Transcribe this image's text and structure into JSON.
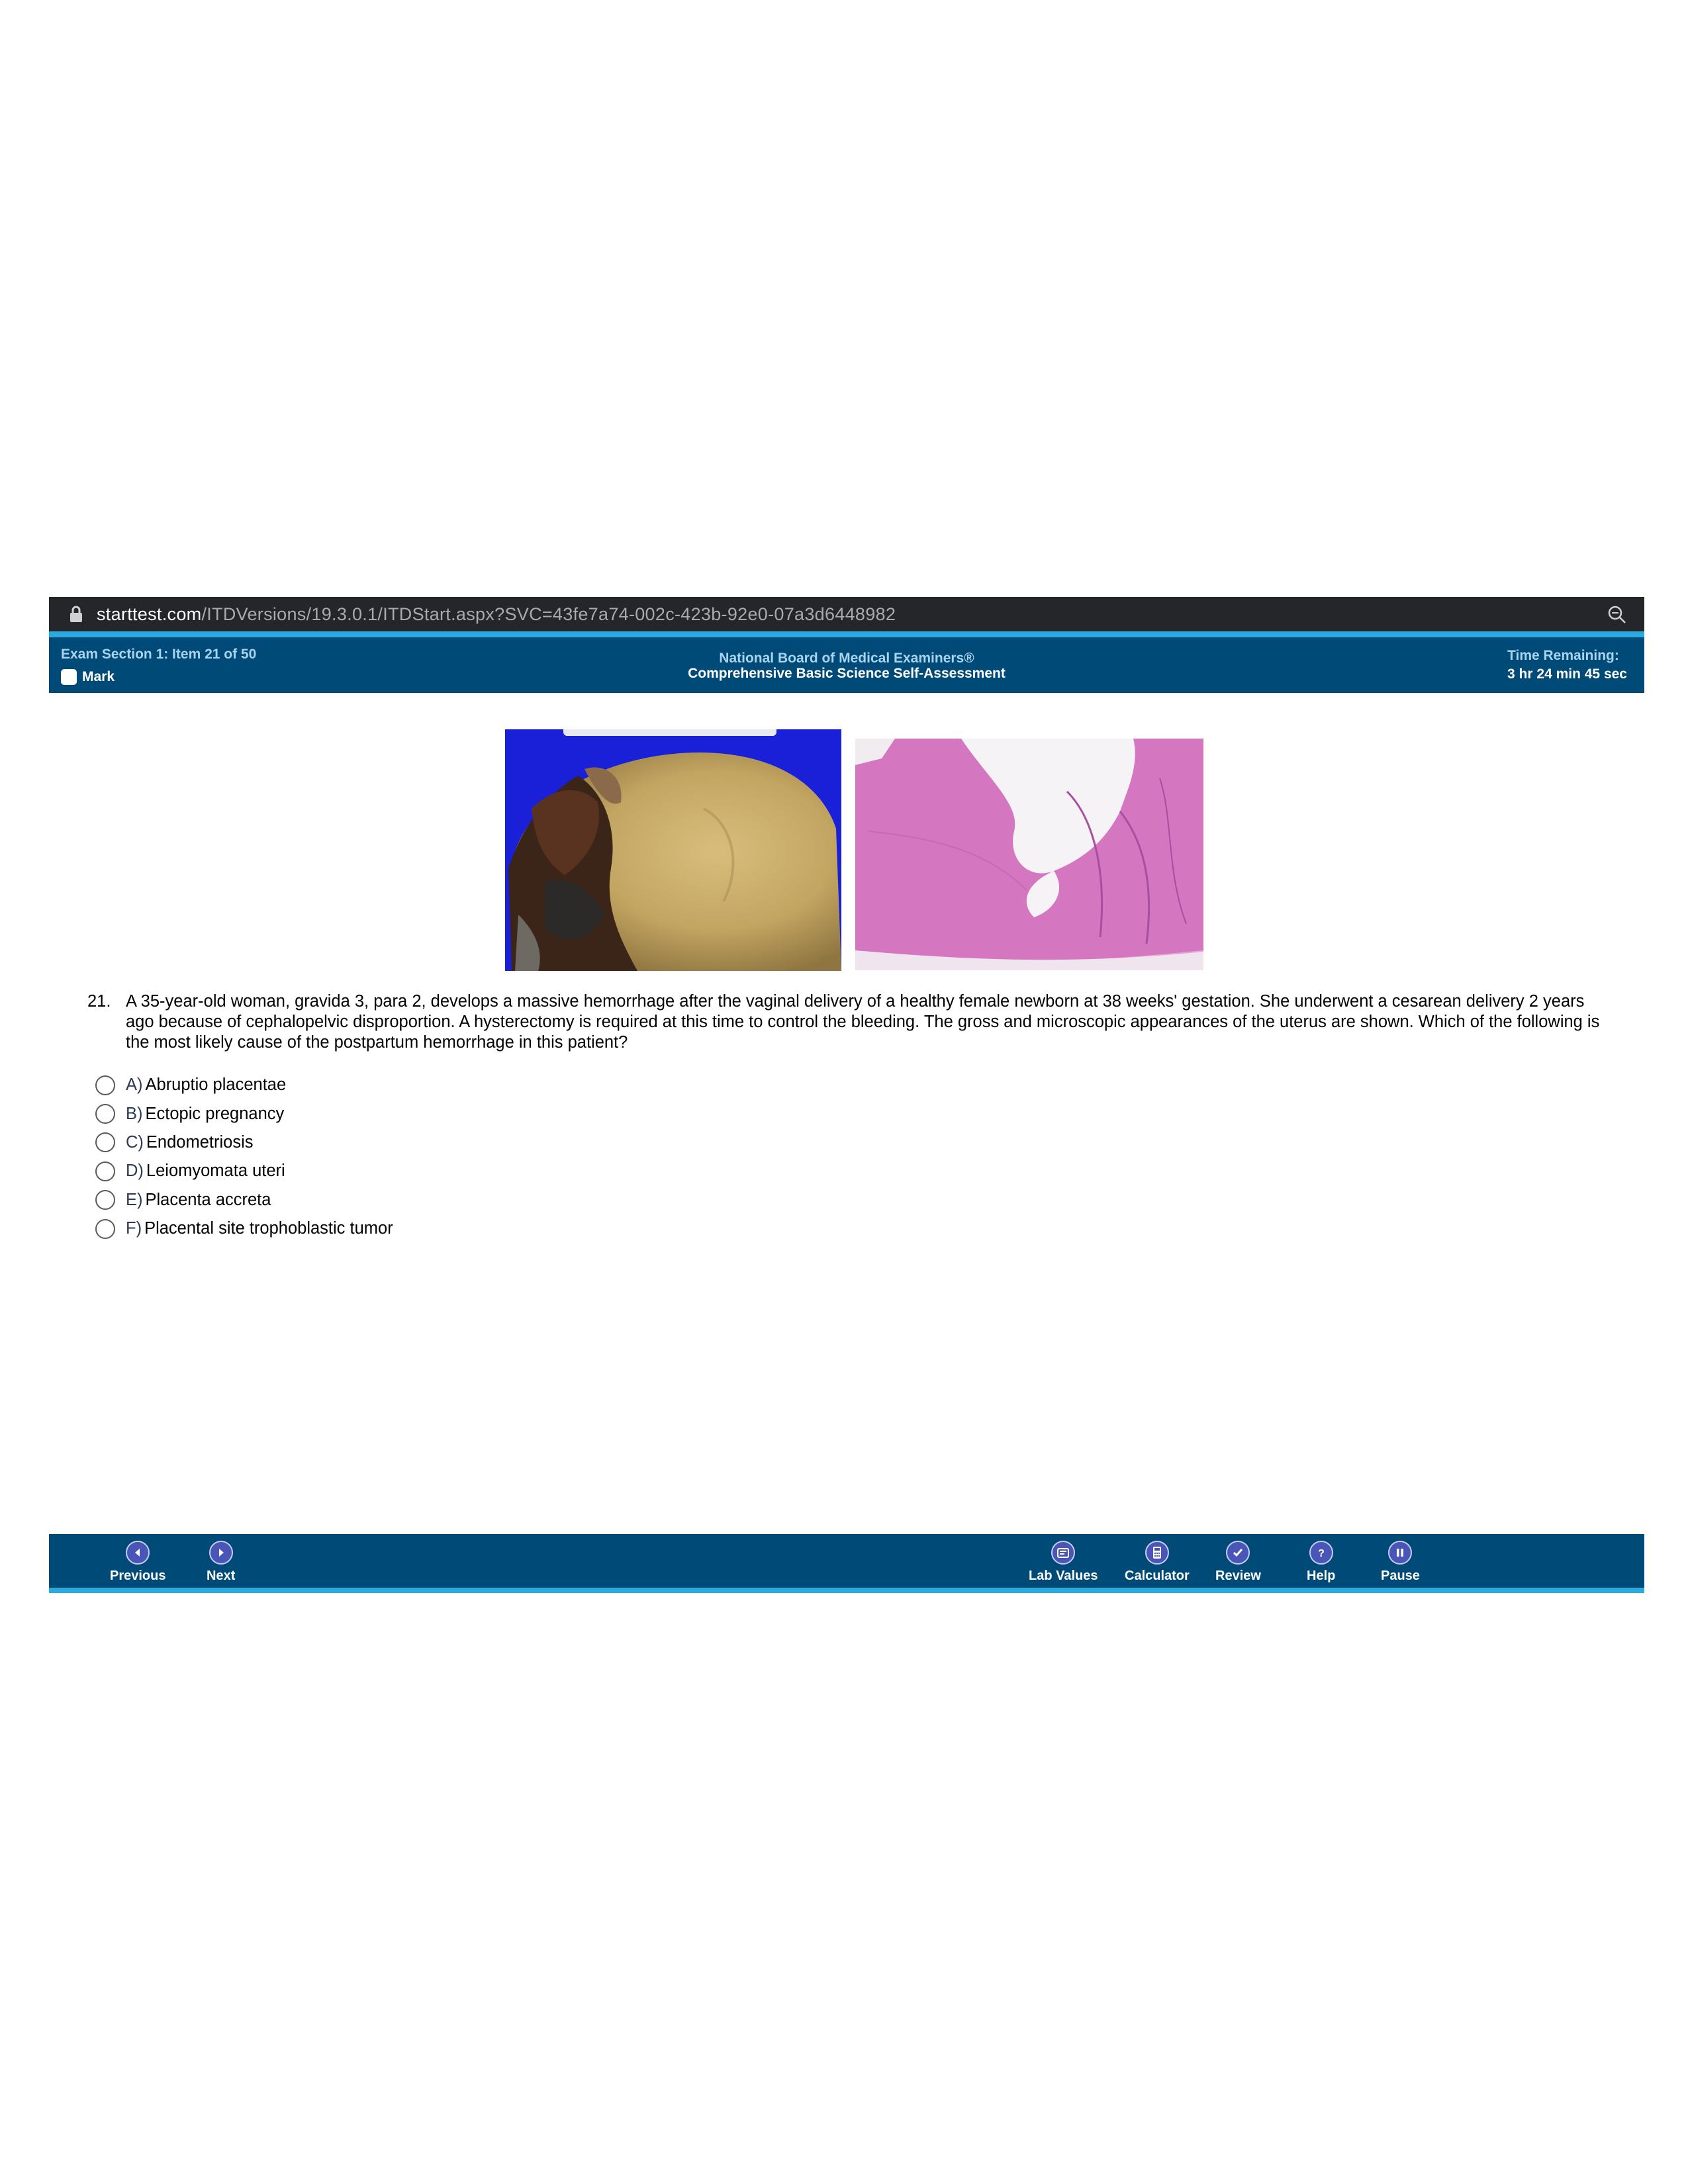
{
  "browser": {
    "url_domain": "starttest.com",
    "url_path": "/ITDVersions/19.3.0.1/ITDStart.aspx?SVC=43fe7a74-002c-423b-92e0-07a3d6448982",
    "icons": [
      "lock-icon",
      "zoom-icon"
    ]
  },
  "header": {
    "section": "Exam Section 1: Item 21 of 50",
    "mark_label": "Mark",
    "org": "National Board of Medical Examiners®",
    "exam_title": "Comprehensive Basic Science Self-Assessment",
    "time_label": "Time Remaining:",
    "time_value": "3 hr 24 min 45 sec"
  },
  "question": {
    "number": "21.",
    "text": "A 35-year-old woman, gravida 3, para 2, develops a massive hemorrhage after the vaginal delivery of a healthy female newborn at 38 weeks' gestation. She underwent a cesarean delivery 2 years ago because of cephalopelvic disproportion. A hysterectomy is required at this time to control the bleeding. The gross and microscopic appearances of the uterus are shown. Which of the following is the most likely cause of the postpartum hemorrhage in this patient?",
    "options": [
      {
        "letter": "A)",
        "text": "Abruptio placentae"
      },
      {
        "letter": "B)",
        "text": "Ectopic pregnancy"
      },
      {
        "letter": "C)",
        "text": "Endometriosis"
      },
      {
        "letter": "D)",
        "text": "Leiomyomata uteri"
      },
      {
        "letter": "E)",
        "text": "Placenta accreta"
      },
      {
        "letter": "F)",
        "text": "Placental site trophoblastic tumor"
      }
    ]
  },
  "nav": {
    "previous": "Previous",
    "next": "Next",
    "lab_values": "Lab Values",
    "calculator": "Calculator",
    "review": "Review",
    "help": "Help",
    "pause": "Pause"
  },
  "colors": {
    "header_bg": "#004a78",
    "accent": "#29abe2",
    "urlbar_bg": "#25262a",
    "icon_fill": "#4a55b8"
  }
}
